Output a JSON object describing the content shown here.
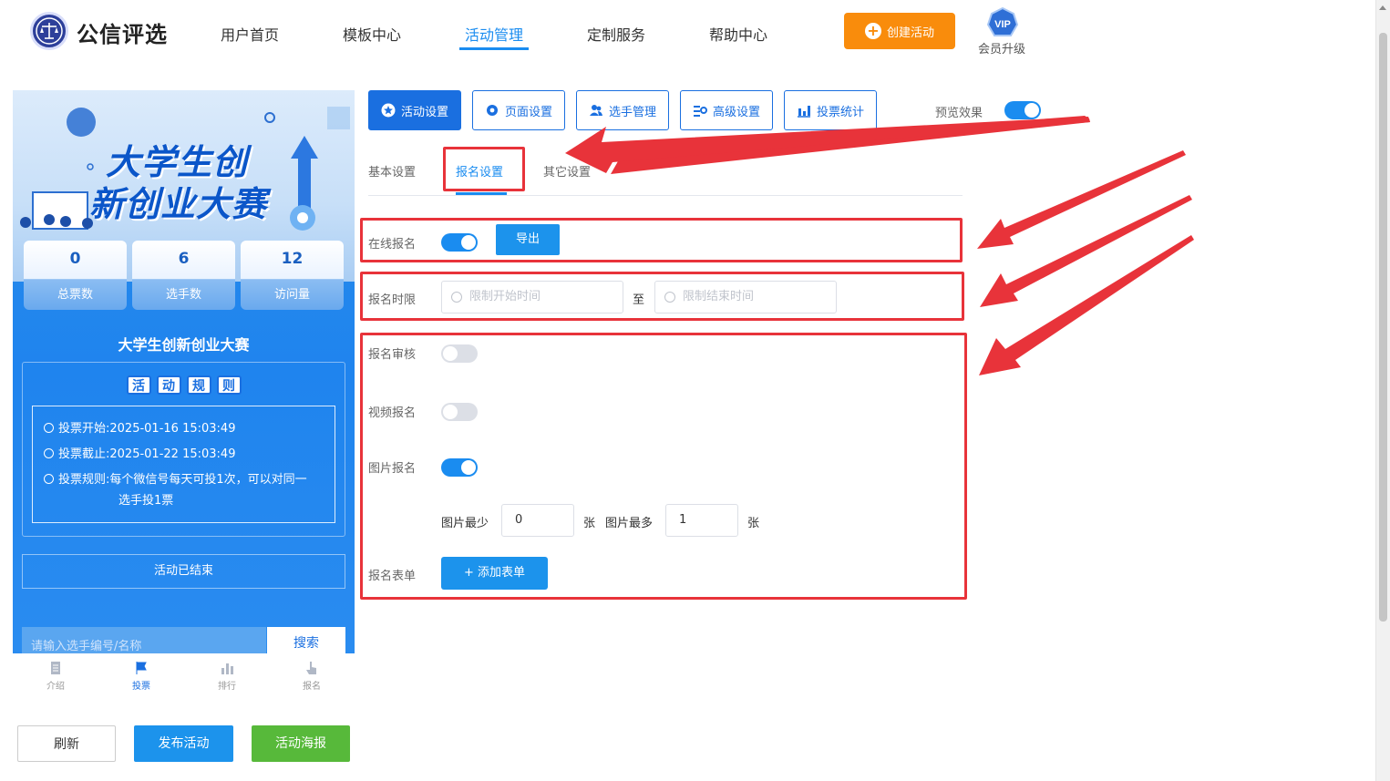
{
  "header": {
    "brand": "公信评选",
    "nav": [
      "用户首页",
      "模板中心",
      "活动管理",
      "定制服务",
      "帮助中心"
    ],
    "active_nav": "活动管理",
    "create_button": "创建活动",
    "vip_badge": "VIP",
    "vip_label": "会员升级",
    "accent_color": "#1a8cf0",
    "create_color": "#f98c0c"
  },
  "preview": {
    "banner_line1": "大学生创",
    "banner_line2": "新创业大赛",
    "stats": [
      {
        "value": "0",
        "label": "总票数"
      },
      {
        "value": "6",
        "label": "选手数"
      },
      {
        "value": "12",
        "label": "访问量"
      }
    ],
    "title": "大学生创新创业大赛",
    "rules_chars": [
      "活",
      "动",
      "规",
      "则"
    ],
    "rules": {
      "start_label": "投票开始:",
      "start_value": "2025-01-16 15:03:49",
      "end_label": "投票截止:",
      "end_value": "2025-01-22 15:03:49",
      "rule_label": "投票规则:",
      "rule_text_1": "每个微信号每天可投1次，可以对同一",
      "rule_text_2": "选手投1票"
    },
    "status": "活动已结束",
    "search_placeholder": "请输入选手编号/名称",
    "search_button": "搜索",
    "tabbar": [
      "介绍",
      "投票",
      "排行",
      "报名"
    ],
    "active_tab": "投票"
  },
  "bottom_buttons": {
    "refresh": "刷新",
    "publish": "发布活动",
    "poster": "活动海报"
  },
  "settings": {
    "tabs": [
      "活动设置",
      "页面设置",
      "选手管理",
      "高级设置",
      "投票统计"
    ],
    "active_tab": "活动设置",
    "preview_label": "预览效果",
    "preview_on": true,
    "subtabs": [
      "基本设置",
      "报名设置",
      "其它设置"
    ],
    "active_subtab": "报名设置",
    "online_signup": {
      "label": "在线报名",
      "on": true,
      "export_button": "导出"
    },
    "signup_period": {
      "label": "报名时限",
      "start_placeholder": "限制开始时间",
      "separator": "至",
      "end_placeholder": "限制结束时间"
    },
    "signup_review": {
      "label": "报名审核",
      "on": false
    },
    "video_signup": {
      "label": "视频报名",
      "on": false
    },
    "image_signup": {
      "label": "图片报名",
      "on": true
    },
    "image_limits": {
      "min_label": "图片最少",
      "min_value": "0",
      "unit": "张",
      "max_label": "图片最多",
      "max_value": "1"
    },
    "signup_form": {
      "label": "报名表单",
      "add_button": "+ 添加表单"
    }
  },
  "annotation_color": "#e8333a"
}
